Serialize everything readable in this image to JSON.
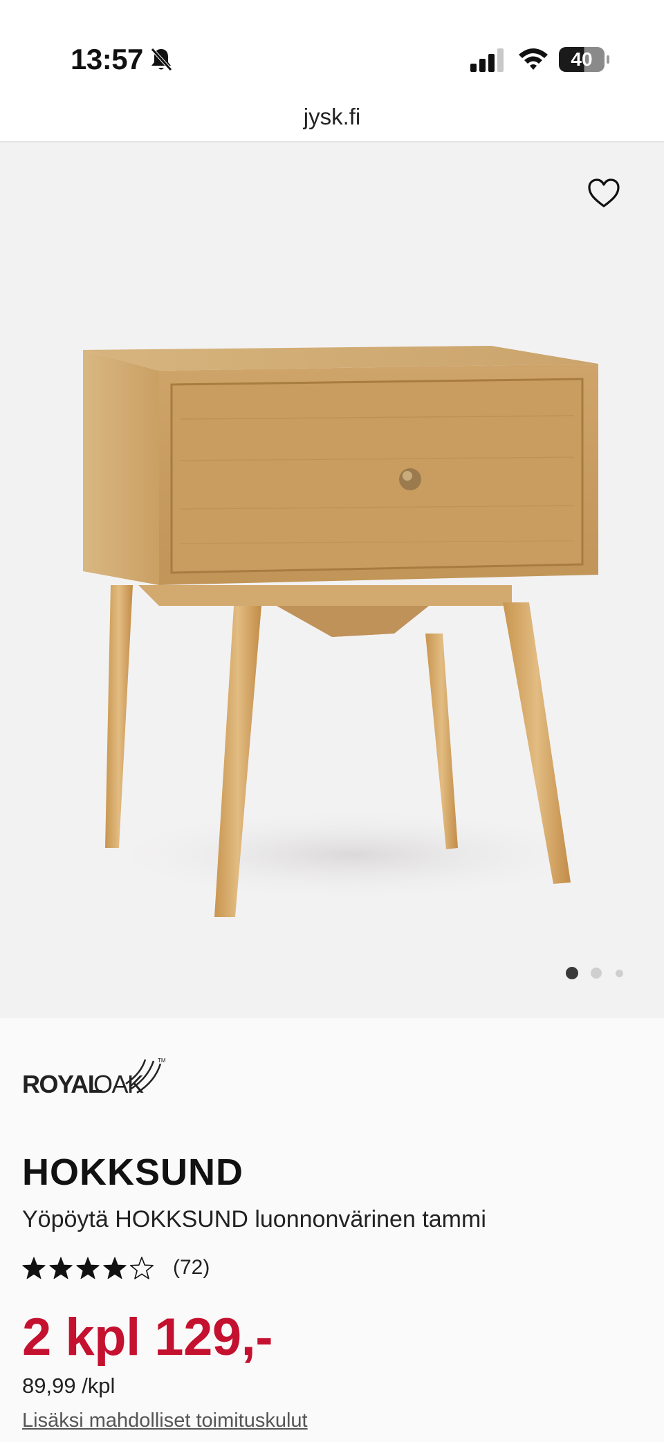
{
  "status_bar": {
    "time": "13:57",
    "battery_percent": 40,
    "battery_text": "40",
    "icons": [
      "bell-muted-icon",
      "cellular-signal-icon",
      "wifi-icon",
      "battery-icon"
    ]
  },
  "browser": {
    "url": "jysk.fi"
  },
  "gallery": {
    "favorite_icon": "heart-outline-icon",
    "image_count": 3,
    "active_image_index": 0
  },
  "product": {
    "brand": "ROYALOAK",
    "name": "HOKKSUND",
    "description": "Yöpöytä HOKKSUND luonnonvärinen tammi",
    "rating": 4,
    "rating_max": 5,
    "review_count": "(72)",
    "price": "2 kpl 129,-",
    "unit_price": "89,99 /kpl",
    "shipping_link": "Lisäksi mahdolliset toimituskulut"
  },
  "colors": {
    "price_red": "#c4112f",
    "gallery_bg": "#f3f2f3",
    "wood": "#d9b27a"
  }
}
